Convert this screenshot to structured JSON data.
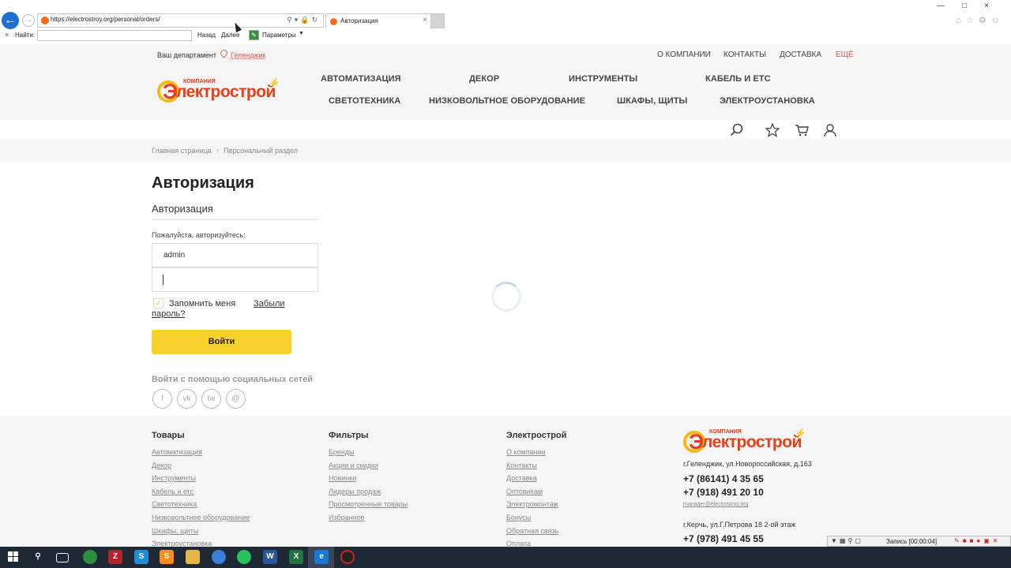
{
  "browser": {
    "url": "https://electrostroy.org/personal/orders/",
    "tab_title": "Авторизация",
    "find_label": "Найти:",
    "find_prev": "Назад",
    "find_next": "Далее",
    "find_options": "Параметры"
  },
  "header": {
    "dept_label": "Ваш департамент",
    "dept_city": "Геленджик",
    "top_nav": [
      "О КОМПАНИИ",
      "КОНТАКТЫ",
      "ДОСТАВКА",
      "ЕЩЁ"
    ],
    "logo_company": "КОМПАНИЯ",
    "logo_name": "лектрострой",
    "logo_letter": "Э",
    "categories_row1": [
      "АВТОМАТИЗАЦИЯ",
      "ДЕКОР",
      "ИНСТРУМЕНТЫ",
      "КАБЕЛЬ И ЕТС"
    ],
    "categories_row2": [
      "СВЕТОТЕХНИКА",
      "НИЗКОВОЛЬТНОЕ ОБОРУДОВАНИЕ",
      "ШКАФЫ, ЩИТЫ",
      "ЭЛЕКТРОУСТАНОВКА"
    ],
    "icons": [
      "search-icon",
      "favorites-icon",
      "cart-icon",
      "user-icon"
    ]
  },
  "breadcrumb": {
    "home": "Главная страница",
    "sep": "›",
    "current": "Персональный раздел"
  },
  "auth": {
    "page_title": "Авторизация",
    "subtitle": "Авторизация",
    "prompt": "Пожалуйста, авторизуйтесь:",
    "login_value": "admin",
    "remember_label": "Запомнить меня",
    "forgot_1": "Забыли",
    "forgot_2": "пароль?",
    "login_button": "Войти",
    "social_title": "Войти с помощью социальных сетей",
    "social": [
      "f",
      "vk",
      "tw",
      "@"
    ]
  },
  "footer": {
    "col1_title": "Товары",
    "col1_links": [
      "Автоматизация",
      "Декор",
      "Инструменты",
      "Кабель и етс",
      "Светотехника",
      "Низковольтное оборудование",
      "Шкафы, щиты",
      "Электроустановка"
    ],
    "col2_title": "Фильтры",
    "col2_links": [
      "Бренды",
      "Акции и скидки",
      "Новинки",
      "Лидеры продаж",
      "Просмотренные товары",
      "Избранное"
    ],
    "col3_title": "Электрострой",
    "col3_links": [
      "О компании",
      "Контакты",
      "Доставка",
      "Оптовикам",
      "Электромонтаж",
      "Бонусы",
      "Обратная связь",
      "Оплата"
    ],
    "address1": "г.Геленджик, ул.Новороссийская, д.163",
    "phone1": "+7 (86141) 4 35 65",
    "phone2": "+7 (918) 491 20 10",
    "email": "manager@electrostroy.org",
    "address2": "г.Керчь, ул.Г.Петрова 18 2-ой этаж",
    "phone3": "+7 (978) 491 45 55"
  },
  "recorder": {
    "label": "Запись [00:00:04]"
  },
  "colors": {
    "accent_yellow": "#f6d12b",
    "brand_red": "#e8401c",
    "link_red": "#e35a4a"
  }
}
